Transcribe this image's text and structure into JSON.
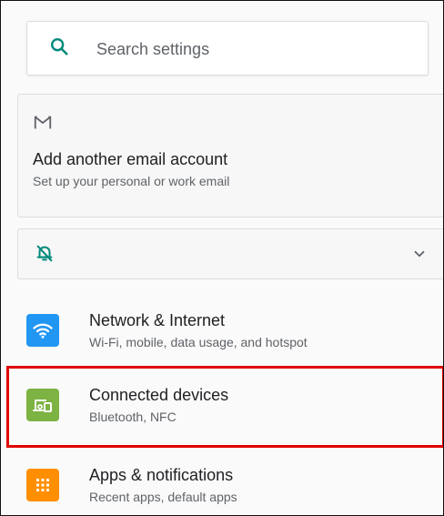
{
  "search": {
    "placeholder": "Search settings",
    "icon": "search-icon"
  },
  "suggestion_email": {
    "icon": "gmail-icon",
    "title": "Add another email account",
    "summary": "Set up your personal or work email"
  },
  "suggestion_notifications": {
    "icon": "bell-off-icon",
    "expand_icon": "chevron-down-icon"
  },
  "settings_items": [
    {
      "label": "Network & Internet",
      "summary": "Wi-Fi, mobile, data usage, and hotspot",
      "icon": "wifi-icon",
      "color": "#2196F3"
    },
    {
      "label": "Connected devices",
      "summary": "Bluetooth, NFC",
      "icon": "devices-icon",
      "color": "#7CB342"
    },
    {
      "label": "Apps & notifications",
      "summary": "Recent apps, default apps",
      "icon": "apps-grid-icon",
      "color": "#FF8F00"
    }
  ],
  "colors": {
    "accent": "#00897B",
    "highlight": "#E00000"
  }
}
